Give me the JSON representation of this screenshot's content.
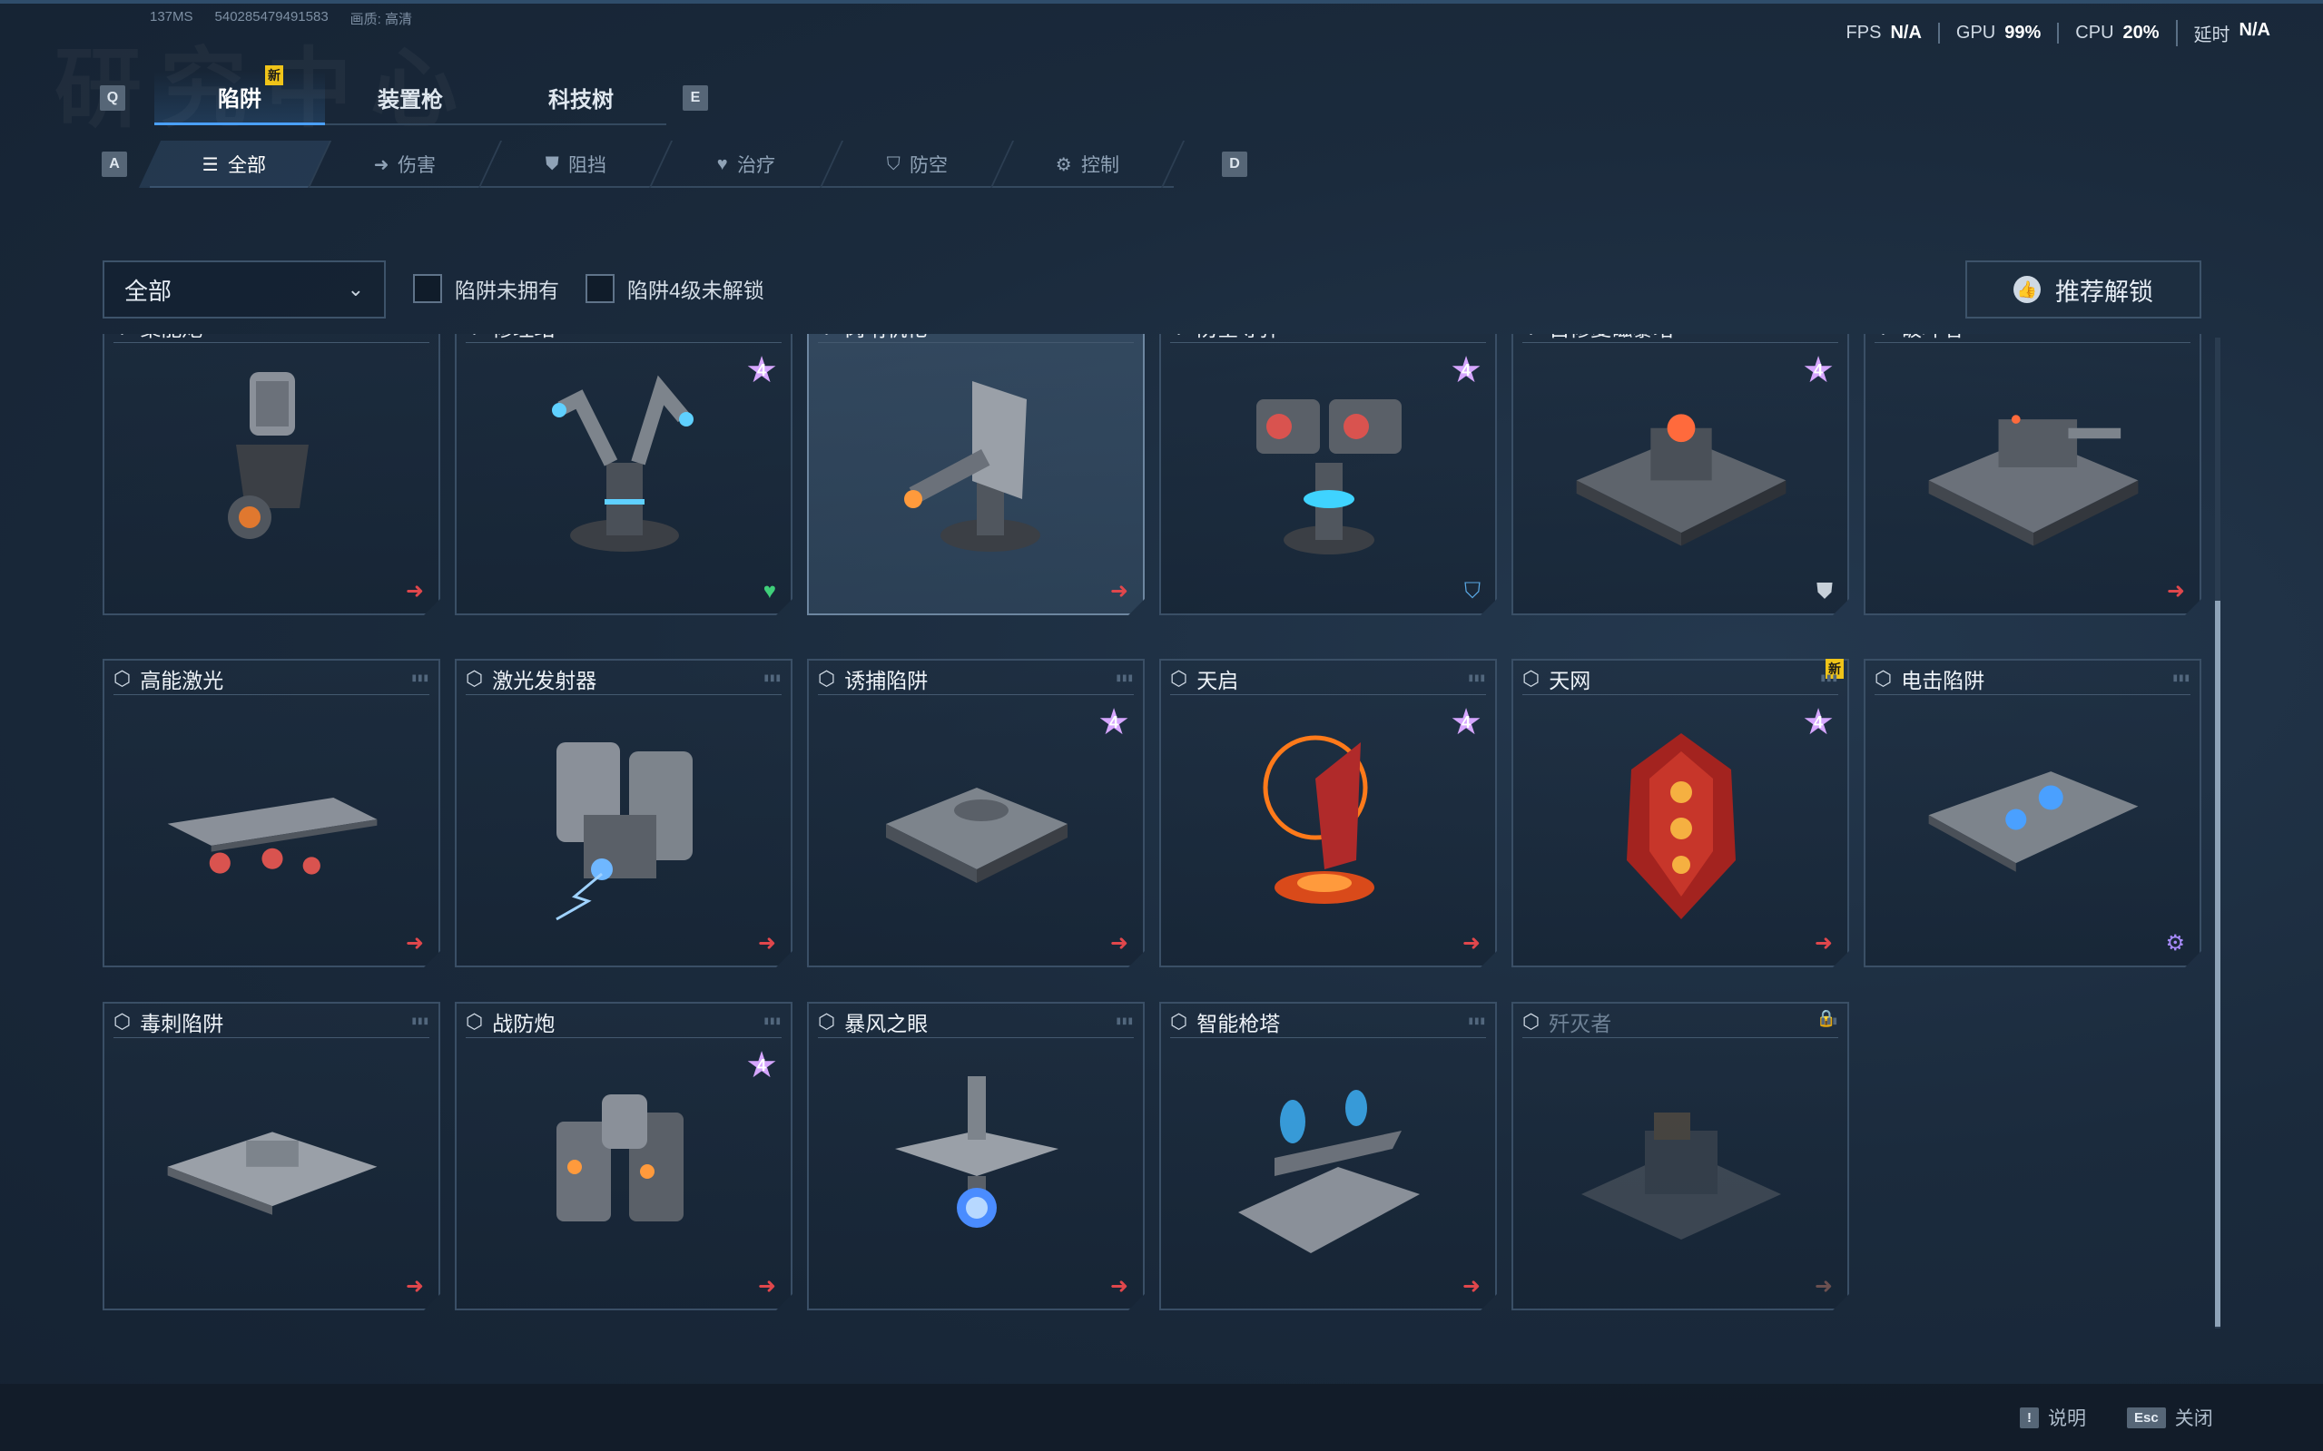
{
  "sysinfo": {
    "latency": "137MS",
    "id": "540285479491583",
    "quality": "画质: 高清"
  },
  "watermark": "研究中心",
  "perf": [
    {
      "label": "FPS",
      "value": "N/A"
    },
    {
      "label": "GPU",
      "value": "99%"
    },
    {
      "label": "CPU",
      "value": "20%"
    },
    {
      "label": "延时",
      "value": "N/A"
    }
  ],
  "keys": {
    "prev_tab": "Q",
    "next_tab": "E",
    "prev_sub": "A",
    "next_sub": "D"
  },
  "tabs": [
    {
      "label": "陷阱",
      "badge": "新"
    },
    {
      "label": "装置枪"
    },
    {
      "label": "科技树"
    }
  ],
  "subtabs": [
    {
      "label": "全部",
      "icon": "list-icon"
    },
    {
      "label": "伤害",
      "icon": "arrow-icon"
    },
    {
      "label": "阻挡",
      "icon": "shield-icon"
    },
    {
      "label": "治疗",
      "icon": "heart-icon"
    },
    {
      "label": "防空",
      "icon": "anti-air-icon"
    },
    {
      "label": "控制",
      "icon": "gear-icon"
    }
  ],
  "filter": {
    "dropdown_value": "全部",
    "check1": "陷阱未拥有",
    "check2": "陷阱4级未解锁",
    "recommend": "推荐解锁"
  },
  "cards": [
    {
      "name": "聚能炮",
      "star": null,
      "footer": "damage-arrow-icon"
    },
    {
      "name": "修理站",
      "star": "4",
      "footer": "heal-icon"
    },
    {
      "name": "岗哨机枪",
      "star": null,
      "footer": "damage-arrow-icon",
      "highlight": true
    },
    {
      "name": "防空导弹",
      "star": "4",
      "footer": "anti-air-icon"
    },
    {
      "name": "自修复磁暴塔",
      "star": "4",
      "footer": "block-shield-icon"
    },
    {
      "name": "破坏者",
      "star": null,
      "footer": "damage-arrow-icon"
    },
    {
      "name": "高能激光",
      "star": null,
      "footer": "damage-arrow-icon"
    },
    {
      "name": "激光发射器",
      "star": null,
      "footer": "damage-arrow-icon"
    },
    {
      "name": "诱捕陷阱",
      "star": "4",
      "footer": "damage-arrow-icon"
    },
    {
      "name": "天启",
      "star": "4",
      "footer": "damage-arrow-icon"
    },
    {
      "name": "天网",
      "star": "4",
      "footer": "damage-arrow-icon",
      "new": "新"
    },
    {
      "name": "电击陷阱",
      "star": null,
      "footer": "control-gear-icon"
    },
    {
      "name": "毒刺陷阱",
      "star": null,
      "footer": "damage-arrow-icon"
    },
    {
      "name": "战防炮",
      "star": "4",
      "footer": "damage-arrow-icon"
    },
    {
      "name": "暴风之眼",
      "star": null,
      "footer": "damage-arrow-icon"
    },
    {
      "name": "智能枪塔",
      "star": null,
      "footer": "damage-arrow-icon"
    },
    {
      "name": "歼灭者",
      "star": null,
      "footer": "damage-arrow-icon",
      "locked": true
    }
  ],
  "bottom": {
    "help_key": "!",
    "help": "说明",
    "close_key": "Esc",
    "close": "关闭"
  }
}
